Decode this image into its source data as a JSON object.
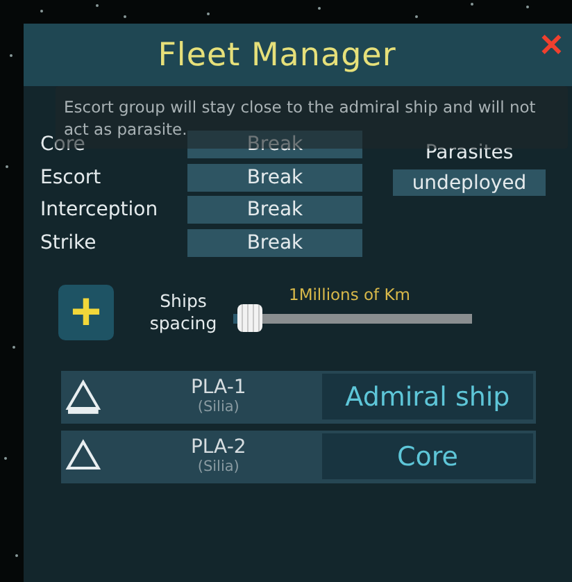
{
  "window": {
    "title": "Fleet Manager",
    "close": "✕"
  },
  "tooltip": "Escort group will stay close to the admiral ship and will not act as parasite.",
  "groups": [
    {
      "label": "Core",
      "action": "Break"
    },
    {
      "label": "Escort",
      "action": "Break"
    },
    {
      "label": "Interception",
      "action": "Break"
    },
    {
      "label": "Strike",
      "action": "Break"
    }
  ],
  "parasites": {
    "label": "Parasites",
    "action": "undeployed"
  },
  "add_button": "+",
  "spacing": {
    "label": "Ships spacing",
    "reading": "1Millions of Km",
    "level": 0.07
  },
  "ships": [
    {
      "name": "PLA-1",
      "class": "(Silia)",
      "role": "Admiral ship",
      "kind": "admiral"
    },
    {
      "name": "PLA-2",
      "class": "(Silia)",
      "role": "Core",
      "kind": "member"
    }
  ]
}
